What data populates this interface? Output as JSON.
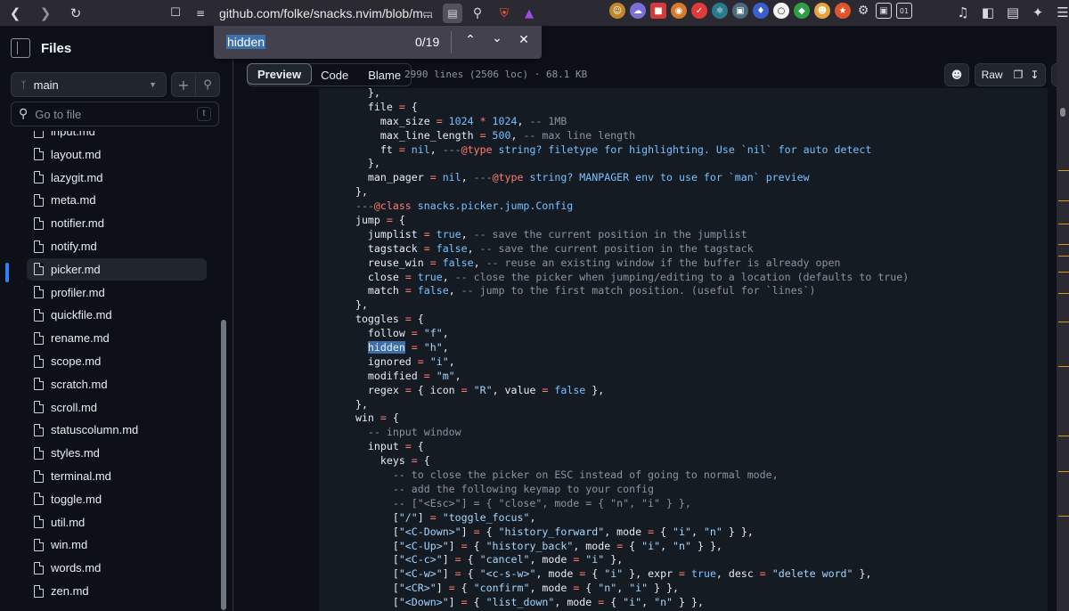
{
  "browser": {
    "url": "github.com/folke/snacks.nvim/blob/m...",
    "colors": {
      "toolbar": "#2b2a33",
      "accent": "#2f81f7"
    }
  },
  "find": {
    "query": "hidden",
    "count": "0/19"
  },
  "sidebar": {
    "title": "Files",
    "branch": "main",
    "goto_placeholder": "Go to file",
    "goto_kbd": "t",
    "files": [
      {
        "name": "input.md"
      },
      {
        "name": "layout.md"
      },
      {
        "name": "lazygit.md"
      },
      {
        "name": "meta.md"
      },
      {
        "name": "notifier.md"
      },
      {
        "name": "notify.md"
      },
      {
        "name": "picker.md",
        "active": true
      },
      {
        "name": "profiler.md"
      },
      {
        "name": "quickfile.md"
      },
      {
        "name": "rename.md"
      },
      {
        "name": "scope.md"
      },
      {
        "name": "scratch.md"
      },
      {
        "name": "scroll.md"
      },
      {
        "name": "statuscolumn.md"
      },
      {
        "name": "styles.md"
      },
      {
        "name": "terminal.md"
      },
      {
        "name": "toggle.md"
      },
      {
        "name": "util.md"
      },
      {
        "name": "win.md"
      },
      {
        "name": "words.md"
      },
      {
        "name": "zen.md"
      }
    ]
  },
  "content": {
    "tabs": [
      "Preview",
      "Code",
      "Blame"
    ],
    "meta": "2990 lines (2506 loc) · 68.1 KB",
    "raw_label": "Raw"
  },
  "code_lines": [
    [
      [
        "    },",
        ""
      ]
    ],
    [
      [
        "    file ",
        ""
      ],
      [
        "=",
        "k"
      ],
      [
        " {",
        ""
      ]
    ],
    [
      [
        "      max_size ",
        ""
      ],
      [
        "=",
        "k"
      ],
      [
        " ",
        ""
      ],
      [
        "1024",
        "n"
      ],
      [
        " ",
        ""
      ],
      [
        "*",
        "k"
      ],
      [
        " ",
        ""
      ],
      [
        "1024",
        "n"
      ],
      [
        ", ",
        ""
      ],
      [
        "-- 1MB",
        "c"
      ]
    ],
    [
      [
        "      max_line_length ",
        ""
      ],
      [
        "=",
        "k"
      ],
      [
        " ",
        ""
      ],
      [
        "500",
        "n"
      ],
      [
        ", ",
        ""
      ],
      [
        "-- max line length",
        "c"
      ]
    ],
    [
      [
        "      ft ",
        ""
      ],
      [
        "=",
        "k"
      ],
      [
        " ",
        ""
      ],
      [
        "nil",
        "n"
      ],
      [
        ", ",
        ""
      ],
      [
        "---",
        "c"
      ],
      [
        "@type",
        "k"
      ],
      [
        " string? filetype for highlighting. Use `nil` for auto detect",
        "t"
      ]
    ],
    [
      [
        "    },",
        ""
      ]
    ],
    [
      [
        "    man_pager ",
        ""
      ],
      [
        "=",
        "k"
      ],
      [
        " ",
        ""
      ],
      [
        "nil",
        "n"
      ],
      [
        ", ",
        ""
      ],
      [
        "---",
        "c"
      ],
      [
        "@type",
        "k"
      ],
      [
        " string? MANPAGER env to use for `man` preview",
        "t"
      ]
    ],
    [
      [
        "  },",
        ""
      ]
    ],
    [
      [
        "  ---",
        "c"
      ],
      [
        "@class",
        "k"
      ],
      [
        " snacks.picker.jump.Config",
        "t"
      ]
    ],
    [
      [
        "  jump ",
        ""
      ],
      [
        "=",
        "k"
      ],
      [
        " {",
        ""
      ]
    ],
    [
      [
        "    jumplist ",
        ""
      ],
      [
        "=",
        "k"
      ],
      [
        " ",
        ""
      ],
      [
        "true",
        "n"
      ],
      [
        ", ",
        ""
      ],
      [
        "-- save the current position in the jumplist",
        "c"
      ]
    ],
    [
      [
        "    tagstack ",
        ""
      ],
      [
        "=",
        "k"
      ],
      [
        " ",
        ""
      ],
      [
        "false",
        "n"
      ],
      [
        ", ",
        ""
      ],
      [
        "-- save the current position in the tagstack",
        "c"
      ]
    ],
    [
      [
        "    reuse_win ",
        ""
      ],
      [
        "=",
        "k"
      ],
      [
        " ",
        ""
      ],
      [
        "false",
        "n"
      ],
      [
        ", ",
        ""
      ],
      [
        "-- reuse an existing window if the buffer is already open",
        "c"
      ]
    ],
    [
      [
        "    close ",
        ""
      ],
      [
        "=",
        "k"
      ],
      [
        " ",
        ""
      ],
      [
        "true",
        "n"
      ],
      [
        ", ",
        ""
      ],
      [
        "-- close the picker when jumping/editing to a location (defaults to true)",
        "c"
      ]
    ],
    [
      [
        "    match ",
        ""
      ],
      [
        "=",
        "k"
      ],
      [
        " ",
        ""
      ],
      [
        "false",
        "n"
      ],
      [
        ", ",
        ""
      ],
      [
        "-- jump to the first match position. (useful for `lines`)",
        "c"
      ]
    ],
    [
      [
        "  },",
        ""
      ]
    ],
    [
      [
        "  toggles ",
        ""
      ],
      [
        "=",
        "k"
      ],
      [
        " {",
        ""
      ]
    ],
    [
      [
        "    follow ",
        ""
      ],
      [
        "=",
        "k"
      ],
      [
        " ",
        ""
      ],
      [
        "\"f\"",
        "s"
      ],
      [
        ",",
        ""
      ]
    ],
    [
      [
        "    ",
        ""
      ],
      [
        "hidden",
        "hl"
      ],
      [
        " ",
        ""
      ],
      [
        "=",
        "k"
      ],
      [
        " ",
        ""
      ],
      [
        "\"h\"",
        "s"
      ],
      [
        ",",
        ""
      ]
    ],
    [
      [
        "    ignored ",
        ""
      ],
      [
        "=",
        "k"
      ],
      [
        " ",
        ""
      ],
      [
        "\"i\"",
        "s"
      ],
      [
        ",",
        ""
      ]
    ],
    [
      [
        "    modified ",
        ""
      ],
      [
        "=",
        "k"
      ],
      [
        " ",
        ""
      ],
      [
        "\"m\"",
        "s"
      ],
      [
        ",",
        ""
      ]
    ],
    [
      [
        "    regex ",
        ""
      ],
      [
        "=",
        "k"
      ],
      [
        " { icon ",
        ""
      ],
      [
        "=",
        "k"
      ],
      [
        " ",
        ""
      ],
      [
        "\"R\"",
        "s"
      ],
      [
        ", value ",
        ""
      ],
      [
        "=",
        "k"
      ],
      [
        " ",
        ""
      ],
      [
        "false",
        "n"
      ],
      [
        " },",
        ""
      ]
    ],
    [
      [
        "  },",
        ""
      ]
    ],
    [
      [
        "  win ",
        ""
      ],
      [
        "=",
        "k"
      ],
      [
        " {",
        ""
      ]
    ],
    [
      [
        "    ",
        ""
      ],
      [
        "-- input window",
        "c"
      ]
    ],
    [
      [
        "    input ",
        ""
      ],
      [
        "=",
        "k"
      ],
      [
        " {",
        ""
      ]
    ],
    [
      [
        "      keys ",
        ""
      ],
      [
        "=",
        "k"
      ],
      [
        " {",
        ""
      ]
    ],
    [
      [
        "        ",
        ""
      ],
      [
        "-- to close the picker on ESC instead of going to normal mode,",
        "c"
      ]
    ],
    [
      [
        "        ",
        ""
      ],
      [
        "-- add the following keymap to your config",
        "c"
      ]
    ],
    [
      [
        "        ",
        ""
      ],
      [
        "-- [\"<Esc>\"] = { \"close\", mode = { \"n\", \"i\" } },",
        "c"
      ]
    ],
    [
      [
        "        [",
        ""
      ],
      [
        "\"/\"",
        "s"
      ],
      [
        "] ",
        ""
      ],
      [
        "=",
        "k"
      ],
      [
        " ",
        ""
      ],
      [
        "\"toggle_focus\"",
        "s"
      ],
      [
        ",",
        ""
      ]
    ],
    [
      [
        "        [",
        ""
      ],
      [
        "\"<C-Down>\"",
        "s"
      ],
      [
        "] ",
        ""
      ],
      [
        "=",
        "k"
      ],
      [
        " { ",
        ""
      ],
      [
        "\"history_forward\"",
        "s"
      ],
      [
        ", mode ",
        ""
      ],
      [
        "=",
        "k"
      ],
      [
        " { ",
        ""
      ],
      [
        "\"i\"",
        "s"
      ],
      [
        ", ",
        ""
      ],
      [
        "\"n\"",
        "s"
      ],
      [
        " } },",
        ""
      ]
    ],
    [
      [
        "        [",
        ""
      ],
      [
        "\"<C-Up>\"",
        "s"
      ],
      [
        "] ",
        ""
      ],
      [
        "=",
        "k"
      ],
      [
        " { ",
        ""
      ],
      [
        "\"history_back\"",
        "s"
      ],
      [
        ", mode ",
        ""
      ],
      [
        "=",
        "k"
      ],
      [
        " { ",
        ""
      ],
      [
        "\"i\"",
        "s"
      ],
      [
        ", ",
        ""
      ],
      [
        "\"n\"",
        "s"
      ],
      [
        " } },",
        ""
      ]
    ],
    [
      [
        "        [",
        ""
      ],
      [
        "\"<C-c>\"",
        "s"
      ],
      [
        "] ",
        ""
      ],
      [
        "=",
        "k"
      ],
      [
        " { ",
        ""
      ],
      [
        "\"cancel\"",
        "s"
      ],
      [
        ", mode ",
        ""
      ],
      [
        "=",
        "k"
      ],
      [
        " ",
        ""
      ],
      [
        "\"i\"",
        "s"
      ],
      [
        " },",
        ""
      ]
    ],
    [
      [
        "        [",
        ""
      ],
      [
        "\"<C-w>\"",
        "s"
      ],
      [
        "] ",
        ""
      ],
      [
        "=",
        "k"
      ],
      [
        " { ",
        ""
      ],
      [
        "\"<c-s-w>\"",
        "s"
      ],
      [
        ", mode ",
        ""
      ],
      [
        "=",
        "k"
      ],
      [
        " { ",
        ""
      ],
      [
        "\"i\"",
        "s"
      ],
      [
        " }, expr ",
        ""
      ],
      [
        "=",
        "k"
      ],
      [
        " ",
        ""
      ],
      [
        "true",
        "n"
      ],
      [
        ", desc ",
        ""
      ],
      [
        "=",
        "k"
      ],
      [
        " ",
        ""
      ],
      [
        "\"delete word\"",
        "s"
      ],
      [
        " },",
        ""
      ]
    ],
    [
      [
        "        [",
        ""
      ],
      [
        "\"<CR>\"",
        "s"
      ],
      [
        "] ",
        ""
      ],
      [
        "=",
        "k"
      ],
      [
        " { ",
        ""
      ],
      [
        "\"confirm\"",
        "s"
      ],
      [
        ", mode ",
        ""
      ],
      [
        "=",
        "k"
      ],
      [
        " { ",
        ""
      ],
      [
        "\"n\"",
        "s"
      ],
      [
        ", ",
        ""
      ],
      [
        "\"i\"",
        "s"
      ],
      [
        " } },",
        ""
      ]
    ],
    [
      [
        "        [",
        ""
      ],
      [
        "\"<Down>\"",
        "s"
      ],
      [
        "] ",
        ""
      ],
      [
        "=",
        "k"
      ],
      [
        " { ",
        ""
      ],
      [
        "\"list_down\"",
        "s"
      ],
      [
        ", mode ",
        ""
      ],
      [
        "=",
        "k"
      ],
      [
        " { ",
        ""
      ],
      [
        "\"i\"",
        "s"
      ],
      [
        ", ",
        ""
      ],
      [
        "\"n\"",
        "s"
      ],
      [
        " } },",
        ""
      ]
    ]
  ]
}
